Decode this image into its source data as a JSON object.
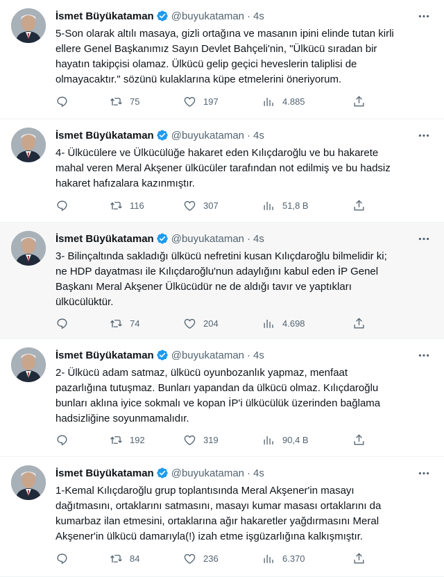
{
  "tweets": [
    {
      "name": "İsmet Büyükataman",
      "handle": "@buyukataman",
      "dot": "·",
      "time": "4s",
      "text": "5-Son olarak altılı masaya, gizli ortağına ve masanın ipini elinde tutan kirli\nellere Genel Başkanımız Sayın Devlet Bahçeli'nin, \"Ülkücü sıradan bir\nhayatın takipçisi olamaz. Ülkücü gelip geçici heveslerin taliplisi de\nolmayacaktır.\" sözünü kulaklarına küpe etmelerini öneriyorum.",
      "reply": "",
      "retweets": "75",
      "likes": "197",
      "views": "4.885"
    },
    {
      "name": "İsmet Büyükataman",
      "handle": "@buyukataman",
      "dot": "·",
      "time": "4s",
      "text": "4- Ülkücülere ve Ülkücülüğe hakaret eden Kılıçdaroğlu ve bu hakarete\nmahal veren Meral Akşener  ülkücüler tarafından not edilmiş ve bu hadsiz\nhakaret hafızalara kazınmıştır.",
      "reply": "",
      "retweets": "116",
      "likes": "307",
      "views": "51,8 B"
    },
    {
      "name": "İsmet Büyükataman",
      "handle": "@buyukataman",
      "dot": "·",
      "time": "4s",
      "text": "3- Bilinçaltında sakladığı ülkücü nefretini kusan Kılıçdaroğlu bilmelidir ki;\nne HDP dayatması ile Kılıçdaroğlu'nun adaylığını kabul eden İP Genel\nBaşkanı Meral Akşener Ülkücüdür ne de aldığı tavır ve yaptıkları\nülkücülüktür.",
      "reply": "",
      "retweets": "74",
      "likes": "204",
      "views": "4.698"
    },
    {
      "name": "İsmet Büyükataman",
      "handle": "@buyukataman",
      "dot": "·",
      "time": "4s",
      "text": "2- Ülkücü adam satmaz, ülkücü oyunbozanlık yapmaz, menfaat\npazarlığına tutuşmaz. Bunları yapandan da ülkücü olmaz. Kılıçdaroğlu\nbunları aklına iyice sokmalı ve kopan İP'i ülkücülük üzerinden bağlama\nhadsizliğine soyunmamalıdır.",
      "reply": "",
      "retweets": "192",
      "likes": "319",
      "views": "90,4 B"
    },
    {
      "name": "İsmet Büyükataman",
      "handle": "@buyukataman",
      "dot": "·",
      "time": "4s",
      "text": "1-Kemal Kılıçdaroğlu grup toplantısında Meral Akşener'in masayı\ndağıtmasını, ortaklarını satmasını, masayı kumar masası ortaklarını da\nkumarbaz ilan etmesini, ortaklarına ağır hakaretler yağdırmasını Meral\nAkşener'in ülkücü damarıyla(!) izah etme işgüzarlığına kalkışmıştır.",
      "reply": "",
      "retweets": "84",
      "likes": "236",
      "views": "6.370"
    }
  ],
  "colors": {
    "verified": "#1d9bf0",
    "muted": "#536471",
    "text": "#0f1419"
  },
  "icons": [
    "verified-badge-icon",
    "more-icon",
    "reply-icon",
    "retweet-icon",
    "like-icon",
    "views-icon",
    "share-icon"
  ]
}
